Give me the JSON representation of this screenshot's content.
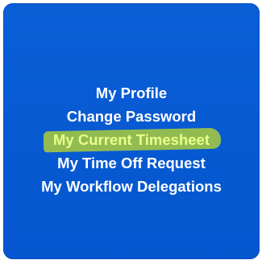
{
  "colors": {
    "tile_background": "#0a5ed6",
    "text": "#ffffff",
    "highlight": "#aacd3c",
    "highlight_text": "#e9ff8a"
  },
  "menu": {
    "items": [
      {
        "label": "My Profile",
        "highlighted": false
      },
      {
        "label": "Change Password",
        "highlighted": false
      },
      {
        "label": "My Current Timesheet",
        "highlighted": true
      },
      {
        "label": "My Time Off Request",
        "highlighted": false
      },
      {
        "label": "My Workflow Delegations",
        "highlighted": false
      }
    ]
  }
}
